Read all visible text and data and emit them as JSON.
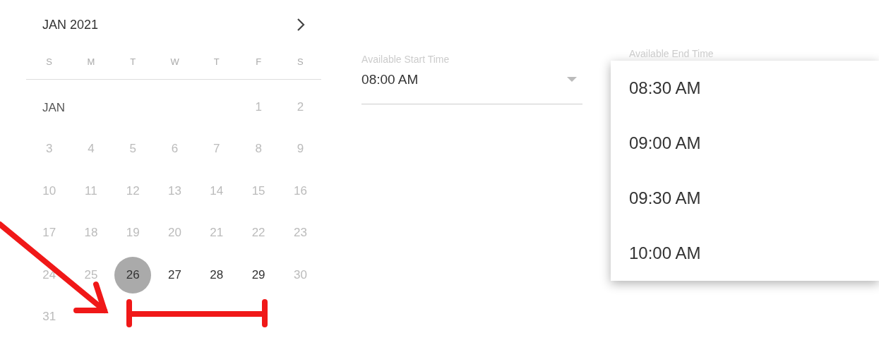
{
  "calendar": {
    "title": "JAN 2021",
    "weekdays": [
      "S",
      "M",
      "T",
      "W",
      "T",
      "F",
      "S"
    ],
    "month_label": "JAN",
    "days": [
      {
        "label": "1",
        "selected": false,
        "disabled": true
      },
      {
        "label": "2",
        "selected": false,
        "disabled": true
      },
      {
        "label": "3",
        "selected": false,
        "disabled": true
      },
      {
        "label": "4",
        "selected": false,
        "disabled": true
      },
      {
        "label": "5",
        "selected": false,
        "disabled": true
      },
      {
        "label": "6",
        "selected": false,
        "disabled": true
      },
      {
        "label": "7",
        "selected": false,
        "disabled": true
      },
      {
        "label": "8",
        "selected": false,
        "disabled": true
      },
      {
        "label": "9",
        "selected": false,
        "disabled": true
      },
      {
        "label": "10",
        "selected": false,
        "disabled": true
      },
      {
        "label": "11",
        "selected": false,
        "disabled": true
      },
      {
        "label": "12",
        "selected": false,
        "disabled": true
      },
      {
        "label": "13",
        "selected": false,
        "disabled": true
      },
      {
        "label": "14",
        "selected": false,
        "disabled": true
      },
      {
        "label": "15",
        "selected": false,
        "disabled": true
      },
      {
        "label": "16",
        "selected": false,
        "disabled": true
      },
      {
        "label": "17",
        "selected": false,
        "disabled": true
      },
      {
        "label": "18",
        "selected": false,
        "disabled": true
      },
      {
        "label": "19",
        "selected": false,
        "disabled": true
      },
      {
        "label": "20",
        "selected": false,
        "disabled": true
      },
      {
        "label": "21",
        "selected": false,
        "disabled": true
      },
      {
        "label": "22",
        "selected": false,
        "disabled": true
      },
      {
        "label": "23",
        "selected": false,
        "disabled": true
      },
      {
        "label": "24",
        "selected": false,
        "disabled": true
      },
      {
        "label": "25",
        "selected": false,
        "disabled": true
      },
      {
        "label": "26",
        "selected": true,
        "disabled": false
      },
      {
        "label": "27",
        "selected": false,
        "disabled": false
      },
      {
        "label": "28",
        "selected": false,
        "disabled": false
      },
      {
        "label": "29",
        "selected": false,
        "disabled": false
      },
      {
        "label": "30",
        "selected": false,
        "disabled": true
      },
      {
        "label": "31",
        "selected": false,
        "disabled": true
      }
    ]
  },
  "start_time": {
    "label": "Available Start Time",
    "value": "08:00 AM"
  },
  "end_time": {
    "label": "Available End Time",
    "options": [
      {
        "label": "08:30 AM"
      },
      {
        "label": "09:00 AM"
      },
      {
        "label": "09:30 AM"
      },
      {
        "label": "10:00 AM"
      }
    ]
  }
}
